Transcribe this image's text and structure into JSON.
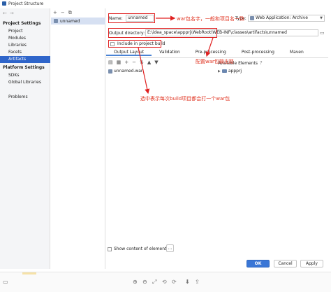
{
  "window": {
    "title": "Project Structure"
  },
  "sidebar": {
    "project_settings_header": "Project Settings",
    "project_settings_items": [
      {
        "label": "Project"
      },
      {
        "label": "Modules"
      },
      {
        "label": "Libraries"
      },
      {
        "label": "Facets"
      },
      {
        "label": "Artifacts"
      }
    ],
    "platform_settings_header": "Platform Settings",
    "platform_settings_items": [
      {
        "label": "SDKs"
      },
      {
        "label": "Global Libraries"
      }
    ],
    "problems_label": "Problems"
  },
  "artifact_list": {
    "toolbar": {
      "add": "+",
      "remove": "−",
      "copy": "⧉"
    },
    "items": [
      {
        "label": "unnamed"
      }
    ]
  },
  "form": {
    "name_label": "Name:",
    "name_value": "unnamed",
    "type_label": "Type:",
    "type_value": "Web Application: Archive",
    "output_dir_label": "Output directory:",
    "output_dir_value": "E:\\idea_space\\appprj\\WebRoot\\WEB-INF\\classes\\artifacts\\unnamed",
    "include_label": "Include in project build"
  },
  "tabs": [
    {
      "label": "Output Layout"
    },
    {
      "label": "Validation"
    },
    {
      "label": "Pre-processing"
    },
    {
      "label": "Post-processing"
    },
    {
      "label": "Maven"
    }
  ],
  "output_layout": {
    "tree_root": "unnamed.war",
    "available_header": "Available Elements",
    "available_items": [
      {
        "label": "appprj"
      }
    ],
    "show_content_label": "Show content of elements",
    "show_content_button": "..."
  },
  "annotations": {
    "name_note": "war包名字，一般和项目名一致",
    "output_note": "配置war包输出路",
    "include_note": "选中表示每次build项目都会打一个war包"
  },
  "buttons": {
    "ok": "OK",
    "cancel": "Cancel",
    "apply": "Apply"
  },
  "colors": {
    "accent": "#2f65ca",
    "annotation": "#e02020",
    "primary_button": "#3a76d6"
  }
}
